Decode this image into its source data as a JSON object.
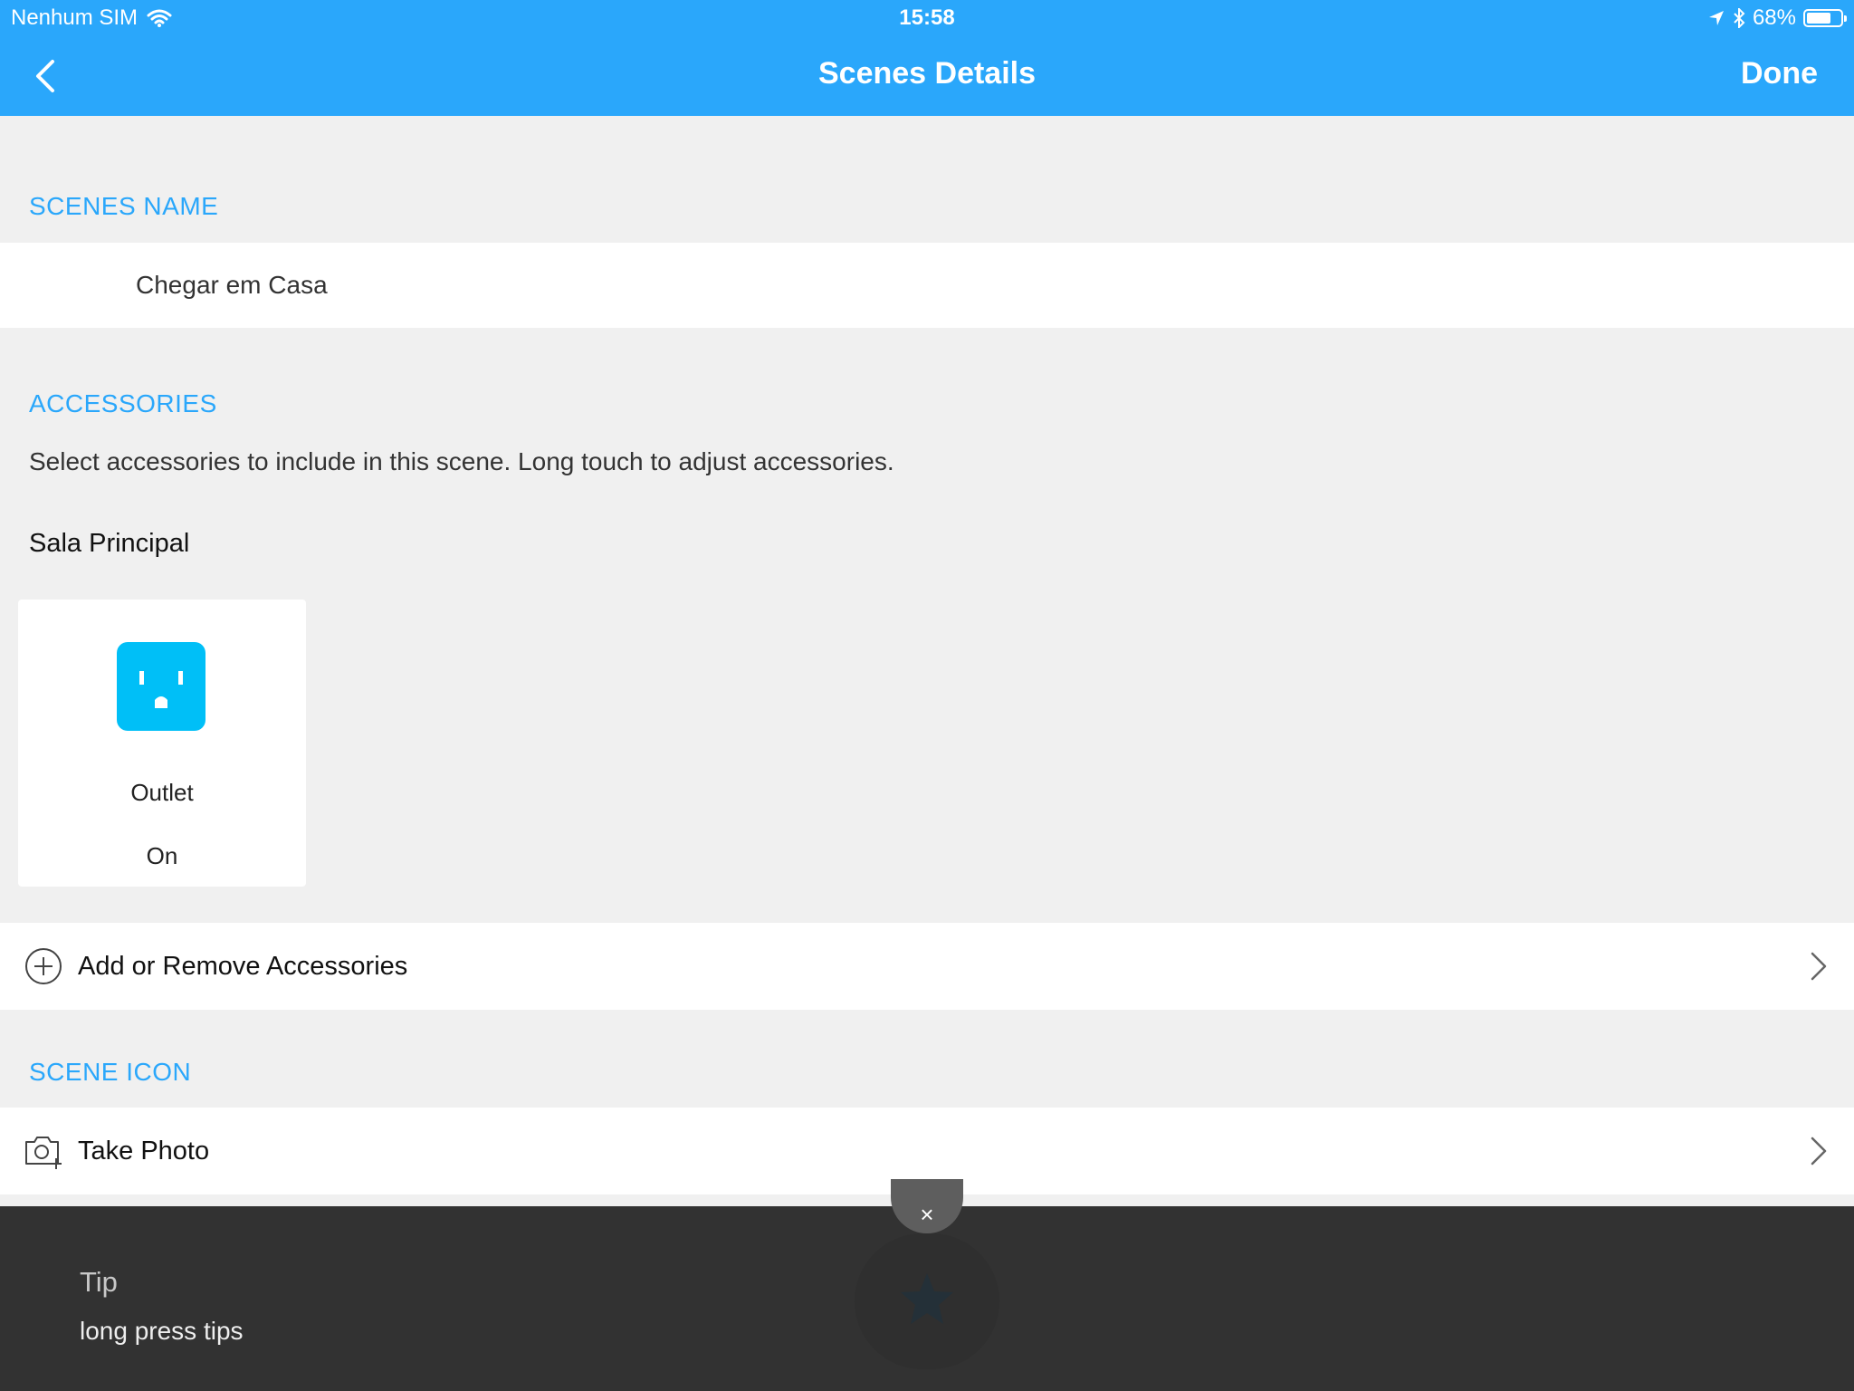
{
  "status_bar": {
    "carrier": "Nenhum SIM",
    "time": "15:58",
    "battery": "68%"
  },
  "nav": {
    "title": "Scenes Details",
    "done_label": "Done"
  },
  "scene_name": {
    "section_label": "SCENES NAME",
    "value": "Chegar em Casa"
  },
  "accessories": {
    "section_label": "ACCESSORIES",
    "description": "Select accessories to include in this scene. Long touch to adjust accessories.",
    "room": "Sala Principal",
    "items": [
      {
        "name": "Outlet",
        "state": "On",
        "icon": "outlet-icon"
      }
    ],
    "add_remove_label": "Add or Remove Accessories"
  },
  "scene_icon": {
    "section_label": "SCENE ICON",
    "take_photo_label": "Take Photo"
  },
  "tip": {
    "title": "Tip",
    "text": "long press tips",
    "close_symbol": "×"
  },
  "colors": {
    "accent": "#2aa7fb",
    "outlet": "#00bff7",
    "tip_background": "#323232"
  }
}
